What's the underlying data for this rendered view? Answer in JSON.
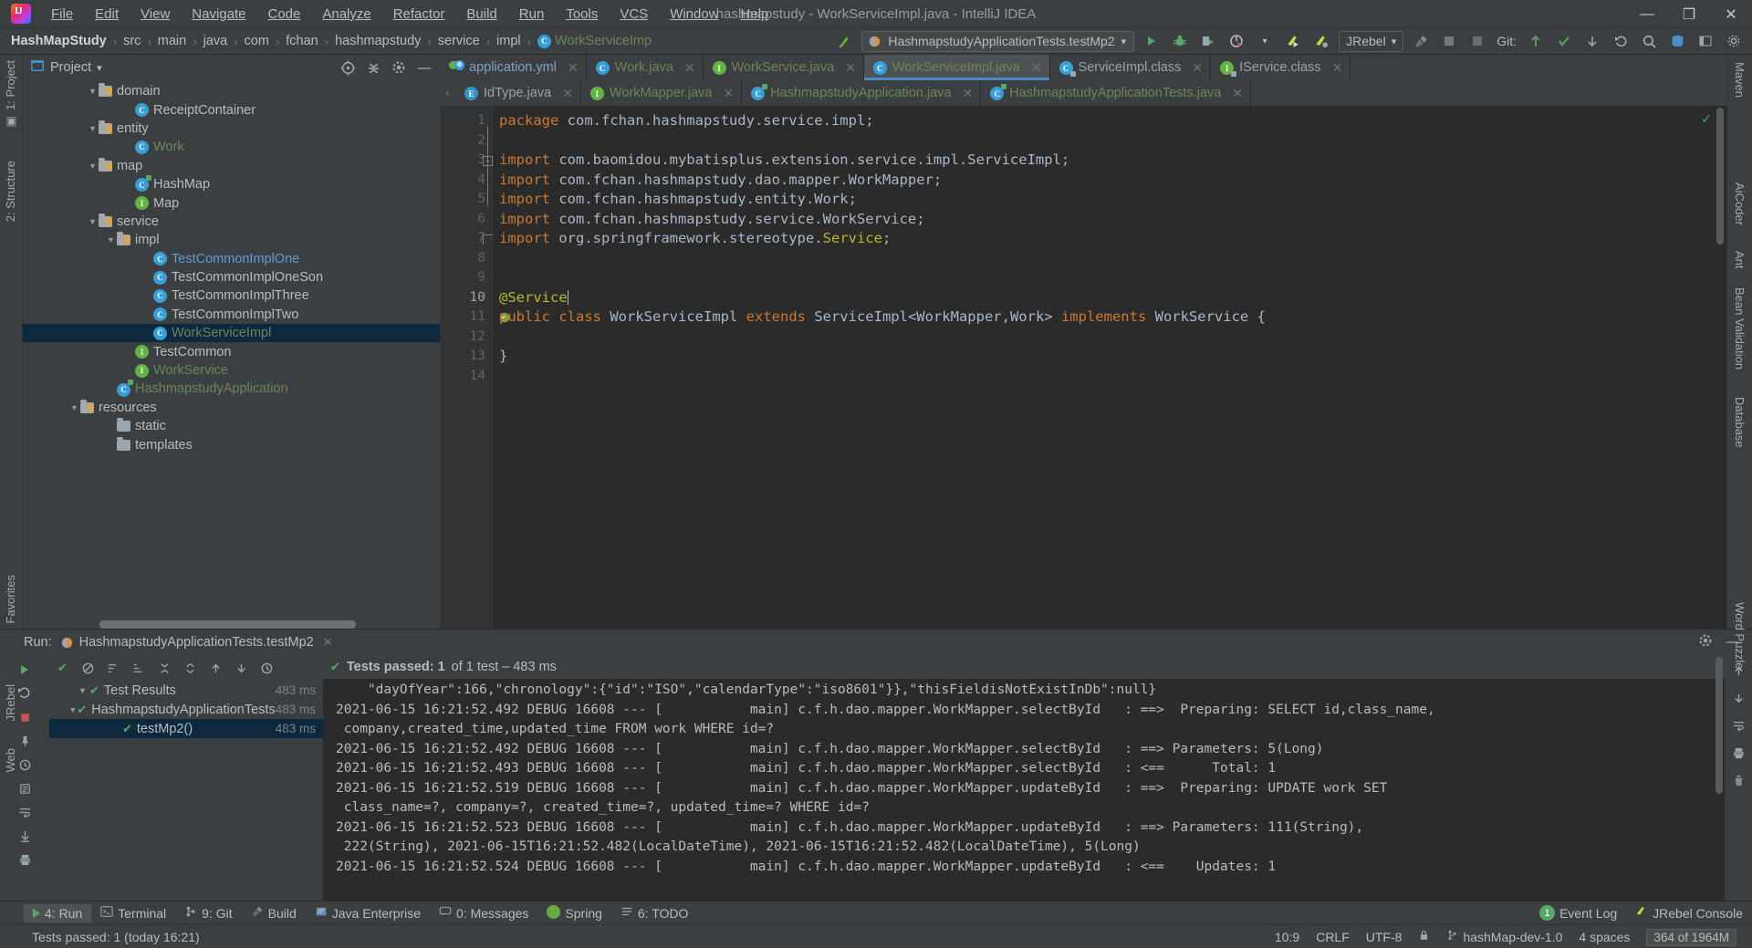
{
  "window": {
    "title": "hashmapstudy - WorkServiceImpl.java - IntelliJ IDEA",
    "minimize": "—",
    "maximize": "❐",
    "close": "✕"
  },
  "menu": {
    "items": [
      "File",
      "Edit",
      "View",
      "Navigate",
      "Code",
      "Analyze",
      "Refactor",
      "Build",
      "Run",
      "Tools",
      "VCS",
      "Window",
      "Help"
    ]
  },
  "breadcrumb": {
    "items": [
      "HashMapStudy",
      "src",
      "main",
      "java",
      "com",
      "fchan",
      "hashmapstudy",
      "service",
      "impl",
      "WorkServiceImp"
    ],
    "separator": "›"
  },
  "toolbar": {
    "run_config": "HashmapstudyApplicationTests.testMp2",
    "run_config_caret": "▾",
    "jrebel": "JRebel",
    "jrebel_caret": "▾",
    "git_label": "Git:",
    "search_icon": "search-icon"
  },
  "project_panel": {
    "title": "Project",
    "caret": "▾",
    "tree": [
      {
        "label": "domain",
        "indent": 3,
        "arrow": "▼",
        "icon": "folder",
        "color": ""
      },
      {
        "label": "ReceiptContainer",
        "indent": 5,
        "arrow": "",
        "icon": "class",
        "color": ""
      },
      {
        "label": "entity",
        "indent": 3,
        "arrow": "▼",
        "icon": "folder",
        "color": ""
      },
      {
        "label": "Work",
        "indent": 5,
        "arrow": "",
        "icon": "class",
        "color": "green"
      },
      {
        "label": "map",
        "indent": 3,
        "arrow": "▼",
        "icon": "folder",
        "color": ""
      },
      {
        "label": "HashMap",
        "indent": 5,
        "arrow": "",
        "icon": "class-run",
        "color": ""
      },
      {
        "label": "Map",
        "indent": 5,
        "arrow": "",
        "icon": "interface",
        "color": ""
      },
      {
        "label": "service",
        "indent": 3,
        "arrow": "▼",
        "icon": "folder",
        "color": ""
      },
      {
        "label": "impl",
        "indent": 4,
        "arrow": "▼",
        "icon": "folder",
        "color": ""
      },
      {
        "label": "TestCommonImplOne",
        "indent": 6,
        "arrow": "",
        "icon": "class",
        "color": "blue"
      },
      {
        "label": "TestCommonImplOneSon",
        "indent": 6,
        "arrow": "",
        "icon": "class",
        "color": ""
      },
      {
        "label": "TestCommonImplThree",
        "indent": 6,
        "arrow": "",
        "icon": "class",
        "color": ""
      },
      {
        "label": "TestCommonImplTwo",
        "indent": 6,
        "arrow": "",
        "icon": "class",
        "color": ""
      },
      {
        "label": "WorkServiceImpl",
        "indent": 6,
        "arrow": "",
        "icon": "class",
        "color": "green",
        "selected": true
      },
      {
        "label": "TestCommon",
        "indent": 5,
        "arrow": "",
        "icon": "interface",
        "color": ""
      },
      {
        "label": "WorkService",
        "indent": 5,
        "arrow": "",
        "icon": "interface",
        "color": "green"
      },
      {
        "label": "HashmapstudyApplication",
        "indent": 4,
        "arrow": "",
        "icon": "class-run",
        "color": "green"
      },
      {
        "label": "resources",
        "indent": 2,
        "arrow": "▼",
        "icon": "folder-res",
        "color": ""
      },
      {
        "label": "static",
        "indent": 4,
        "arrow": "",
        "icon": "folder-plain",
        "color": ""
      },
      {
        "label": "templates",
        "indent": 4,
        "arrow": "",
        "icon": "folder-plain",
        "color": ""
      }
    ]
  },
  "editor": {
    "tabs_row1": [
      {
        "label": "application.yml",
        "icon": "yml-icon",
        "color": "lblue",
        "active": false
      },
      {
        "label": "Work.java",
        "icon": "class",
        "color": "green",
        "active": false
      },
      {
        "label": "WorkService.java",
        "icon": "interface",
        "color": "green",
        "active": false
      },
      {
        "label": "WorkServiceImpl.java",
        "icon": "class",
        "color": "green",
        "active": true
      },
      {
        "label": "ServiceImpl.class",
        "icon": "class-lib",
        "color": "grey",
        "active": false
      },
      {
        "label": "IService.class",
        "icon": "interface-lib",
        "color": "grey",
        "active": false
      }
    ],
    "tabs_row2": [
      {
        "label": "IdType.java",
        "icon": "enum-icon",
        "color": "grey",
        "active": false
      },
      {
        "label": "WorkMapper.java",
        "icon": "interface",
        "color": "green",
        "active": false
      },
      {
        "label": "HashmapstudyApplication.java",
        "icon": "class-run",
        "color": "green",
        "active": false
      },
      {
        "label": "HashmapstudyApplicationTests.java",
        "icon": "class-run",
        "color": "green",
        "active": false
      }
    ],
    "close_glyph": "✕",
    "lines": [
      {
        "n": 1,
        "tokens": [
          {
            "t": "package",
            "c": "kw"
          },
          {
            "t": " com.fchan.hashmapstudy.service.impl;",
            "c": ""
          }
        ]
      },
      {
        "n": 2,
        "tokens": []
      },
      {
        "n": 3,
        "tokens": [
          {
            "t": "import",
            "c": "kw"
          },
          {
            "t": " com.baomidou.mybatisplus.extension.service.impl.ServiceImpl;",
            "c": ""
          }
        ]
      },
      {
        "n": 4,
        "tokens": [
          {
            "t": "import",
            "c": "kw"
          },
          {
            "t": " com.fchan.hashmapstudy.dao.mapper.WorkMapper;",
            "c": ""
          }
        ]
      },
      {
        "n": 5,
        "tokens": [
          {
            "t": "import",
            "c": "kw"
          },
          {
            "t": " com.fchan.hashmapstudy.entity.Work;",
            "c": ""
          }
        ]
      },
      {
        "n": 6,
        "tokens": [
          {
            "t": "import",
            "c": "kw"
          },
          {
            "t": " com.fchan.hashmapstudy.service.WorkService;",
            "c": ""
          }
        ]
      },
      {
        "n": 7,
        "tokens": [
          {
            "t": "import",
            "c": "kw"
          },
          {
            "t": " org.springframework.stereotype.",
            "c": ""
          },
          {
            "t": "Service",
            "c": "ann"
          },
          {
            "t": ";",
            "c": ""
          }
        ]
      },
      {
        "n": 8,
        "tokens": []
      },
      {
        "n": 9,
        "tokens": []
      },
      {
        "n": 10,
        "tokens": [
          {
            "t": "@Service",
            "c": "ann"
          }
        ],
        "caret": true,
        "current": true
      },
      {
        "n": 11,
        "tokens": [
          {
            "t": "public",
            "c": "kw"
          },
          {
            "t": " ",
            "c": ""
          },
          {
            "t": "class",
            "c": "kw"
          },
          {
            "t": " WorkServiceImpl ",
            "c": ""
          },
          {
            "t": "extends",
            "c": "kw"
          },
          {
            "t": " ServiceImpl<WorkMapper,Work> ",
            "c": ""
          },
          {
            "t": "implements",
            "c": "kw"
          },
          {
            "t": " WorkService {",
            "c": ""
          }
        ]
      },
      {
        "n": 12,
        "tokens": []
      },
      {
        "n": 13,
        "tokens": [
          {
            "t": "}",
            "c": ""
          }
        ]
      },
      {
        "n": 14,
        "tokens": []
      }
    ]
  },
  "run_panel": {
    "label": "Run:",
    "tab": "HashmapstudyApplicationTests.testMp2",
    "close_glyph": "✕",
    "settings_icon": "gear-icon",
    "minimize_icon": "—",
    "status": "Tests passed: 1",
    "status_suffix": "of 1 test – 483 ms",
    "tree": [
      {
        "label": "Test Results",
        "indent": 1,
        "arrow": "▼",
        "time": "483 ms",
        "check": true
      },
      {
        "label": "HashmapstudyApplicationTests",
        "indent": 2,
        "arrow": "▼",
        "time": "483 ms",
        "check": true
      },
      {
        "label": "testMp2()",
        "indent": 3,
        "arrow": "",
        "time": "483 ms",
        "check": true,
        "selected": true
      }
    ],
    "console": [
      "    \"dayOfYear\":166,\"chronology\":{\"id\":\"ISO\",\"calendarType\":\"iso8601\"}},\"thisFieldisNotExistInDb\":null}",
      "2021-06-15 16:21:52.492 DEBUG 16608 --- [           main] c.f.h.dao.mapper.WorkMapper.selectById   : ==>  Preparing: SELECT id,class_name,",
      " company,created_time,updated_time FROM work WHERE id=?",
      "2021-06-15 16:21:52.492 DEBUG 16608 --- [           main] c.f.h.dao.mapper.WorkMapper.selectById   : ==> Parameters: 5(Long)",
      "2021-06-15 16:21:52.493 DEBUG 16608 --- [           main] c.f.h.dao.mapper.WorkMapper.selectById   : <==      Total: 1",
      "2021-06-15 16:21:52.519 DEBUG 16608 --- [           main] c.f.h.dao.mapper.WorkMapper.updateById   : ==>  Preparing: UPDATE work SET",
      " class_name=?, company=?, created_time=?, updated_time=? WHERE id=?",
      "2021-06-15 16:21:52.523 DEBUG 16608 --- [           main] c.f.h.dao.mapper.WorkMapper.updateById   : ==> Parameters: 111(String),",
      " 222(String), 2021-06-15T16:21:52.482(LocalDateTime), 2021-06-15T16:21:52.482(LocalDateTime), 5(Long)",
      "2021-06-15 16:21:52.524 DEBUG 16608 --- [           main] c.f.h.dao.mapper.WorkMapper.updateById   : <==    Updates: 1"
    ]
  },
  "left_rail": {
    "items": [
      "1: Project",
      "2: Structure",
      "Favorites",
      "JRebel",
      "Web"
    ]
  },
  "right_rail": {
    "items": [
      "Maven",
      "AiCoder",
      "Ant",
      "Bean Validation",
      "Database",
      "Word Puzzle"
    ]
  },
  "toolwindow_bar": {
    "items": [
      {
        "label": "4: Run",
        "icon": "run-icon",
        "active": true
      },
      {
        "label": "Terminal",
        "icon": "terminal-icon",
        "active": false
      },
      {
        "label": "9: Git",
        "icon": "git-icon",
        "active": false
      },
      {
        "label": "Build",
        "icon": "build-icon",
        "active": false
      },
      {
        "label": "Java Enterprise",
        "icon": "java-ee-icon",
        "active": false
      },
      {
        "label": "0: Messages",
        "icon": "messages-icon",
        "active": false
      },
      {
        "label": "Spring",
        "icon": "spring-icon",
        "active": false
      },
      {
        "label": "6: TODO",
        "icon": "todo-icon",
        "active": false
      }
    ],
    "event_log": "Event Log",
    "event_log_count": "1",
    "jrebel_console": "JRebel Console"
  },
  "statusbar": {
    "message": "Tests passed: 1 (today 16:21)",
    "caret_pos": "10:9",
    "line_sep": "CRLF",
    "encoding": "UTF-8",
    "branch": "hashMap-dev-1.0",
    "indent": "4 spaces",
    "memory": "364 of 1964M"
  },
  "colors": {
    "accent": "#4a88c7",
    "selection": "#0d293e",
    "bg_panel": "#3c3f41",
    "bg_editor": "#2b2b2b",
    "keyword": "#cc7832",
    "annotation": "#bbb529",
    "string": "#6a8759",
    "text": "#a9b7c6",
    "pass_green": "#59a869"
  }
}
